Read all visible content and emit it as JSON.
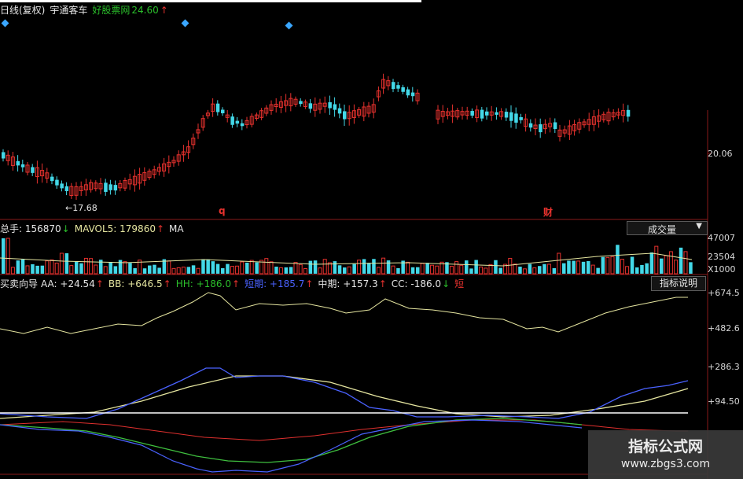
{
  "header": {
    "period": "日线(复权)",
    "stock_name": "宇通客车",
    "source": "好股票网",
    "price": "24.60",
    "price_arrow": "↑"
  },
  "price_panel": {
    "axis_label": "20.06",
    "low_label": "←17.68",
    "marker_q": "q",
    "marker_cai": "财"
  },
  "volume_panel": {
    "total_label": "总手: 156870",
    "total_arrow": "↓",
    "mavol_label": "MAVOL5: 179860",
    "mavol_arrow": "↑",
    "cut_label": "MA",
    "dropdown_value": "成交量",
    "axis_top": "47007",
    "axis_mid": "23504",
    "axis_unit": "X1000"
  },
  "indicator_panel": {
    "name": "买卖向导",
    "aa": "AA: +24.54",
    "aa_arrow": "↑",
    "bb": "BB: +646.5",
    "bb_arrow": "↑",
    "hh": "HH: +186.0",
    "hh_arrow": "↑",
    "short": "短期: +185.7",
    "short_arrow": "↑",
    "mid": "中期: +157.3",
    "mid_arrow": "↑",
    "cc": "CC: -186.0",
    "cc_arrow": "↓",
    "cut_label": "短",
    "help_button": "指标说明",
    "axis": [
      "+674.5",
      "+482.6",
      "+286.3",
      "+94.50"
    ]
  },
  "watermark": {
    "title": "指标公式网",
    "url": "www.zbgs3.com"
  },
  "colors": {
    "up": "#e8322e",
    "down": "#43d8e8",
    "yellow_line": "#e6e6a0",
    "blue_line": "#4a62ff",
    "green_line": "#3fbf3f",
    "red_line": "#e0302e",
    "frame": "#8a1a1a"
  }
}
